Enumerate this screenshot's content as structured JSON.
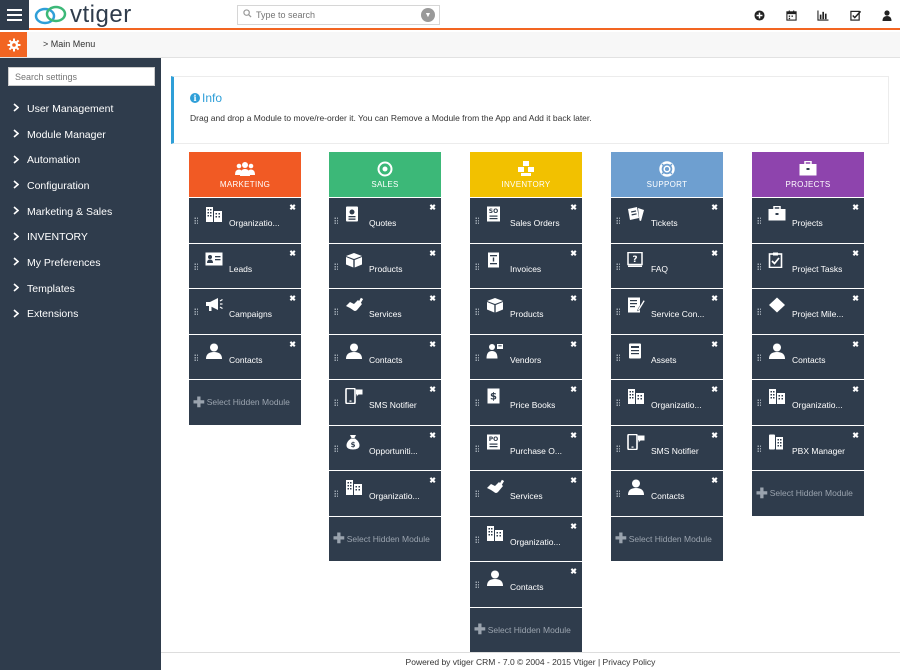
{
  "app": {
    "logo_text": "vtiger"
  },
  "search": {
    "placeholder": "Type to search"
  },
  "header_icons": [
    "plus-circle-icon",
    "calendar-icon",
    "bar-chart-icon",
    "checkbox-icon",
    "user-icon"
  ],
  "breadcrumb": {
    "text": "> Main Menu"
  },
  "sidebar": {
    "search_placeholder": "Search settings",
    "items": [
      {
        "label": "User Management"
      },
      {
        "label": "Module Manager"
      },
      {
        "label": "Automation"
      },
      {
        "label": "Configuration"
      },
      {
        "label": "Marketing & Sales"
      },
      {
        "label": "INVENTORY"
      },
      {
        "label": "My Preferences"
      },
      {
        "label": "Templates"
      },
      {
        "label": "Extensions"
      }
    ]
  },
  "info": {
    "title": "Info",
    "text": "Drag and drop a Module to move/re-order it. You can Remove a Module from the App and Add it back later."
  },
  "hidden_label": "Select Hidden Module",
  "columns": [
    {
      "name": "MARKETING",
      "color": "#f15a24",
      "icon": "users-icon",
      "modules": [
        {
          "label": "Organizatio...",
          "icon": "building-icon"
        },
        {
          "label": "Leads",
          "icon": "id-card-icon"
        },
        {
          "label": "Campaigns",
          "icon": "megaphone-icon"
        },
        {
          "label": "Contacts",
          "icon": "person-icon"
        }
      ]
    },
    {
      "name": "SALES",
      "color": "#3cb878",
      "icon": "target-icon",
      "modules": [
        {
          "label": "Quotes",
          "icon": "quote-doc-icon"
        },
        {
          "label": "Products",
          "icon": "box-icon"
        },
        {
          "label": "Services",
          "icon": "handshake-icon"
        },
        {
          "label": "Contacts",
          "icon": "person-icon"
        },
        {
          "label": "SMS Notifier",
          "icon": "phone-sms-icon"
        },
        {
          "label": "Opportuniti...",
          "icon": "money-bag-icon"
        },
        {
          "label": "Organizatio...",
          "icon": "building-icon"
        }
      ]
    },
    {
      "name": "INVENTORY",
      "color": "#f2c100",
      "icon": "boxes-icon",
      "modules": [
        {
          "label": "Sales Orders",
          "icon": "so-doc-icon"
        },
        {
          "label": "Invoices",
          "icon": "invoice-icon"
        },
        {
          "label": "Products",
          "icon": "box-icon"
        },
        {
          "label": "Vendors",
          "icon": "vendor-icon"
        },
        {
          "label": "Price Books",
          "icon": "pricebook-icon"
        },
        {
          "label": "Purchase O...",
          "icon": "po-doc-icon"
        },
        {
          "label": "Services",
          "icon": "handshake-icon"
        },
        {
          "label": "Organizatio...",
          "icon": "building-icon"
        },
        {
          "label": "Contacts",
          "icon": "person-icon"
        }
      ]
    },
    {
      "name": "SUPPORT",
      "color": "#6e9fd0",
      "icon": "lifebuoy-icon",
      "modules": [
        {
          "label": "Tickets",
          "icon": "ticket-icon"
        },
        {
          "label": "FAQ",
          "icon": "faq-icon"
        },
        {
          "label": "Service Con...",
          "icon": "contract-icon"
        },
        {
          "label": "Assets",
          "icon": "assets-icon"
        },
        {
          "label": "Organizatio...",
          "icon": "building-icon"
        },
        {
          "label": "SMS Notifier",
          "icon": "phone-sms-icon"
        },
        {
          "label": "Contacts",
          "icon": "person-icon"
        }
      ]
    },
    {
      "name": "PROJECTS",
      "color": "#8e44ad",
      "icon": "briefcase-icon",
      "modules": [
        {
          "label": "Projects",
          "icon": "briefcase-icon"
        },
        {
          "label": "Project Tasks",
          "icon": "clipboard-icon"
        },
        {
          "label": "Project Mile...",
          "icon": "diamond-icon"
        },
        {
          "label": "Contacts",
          "icon": "person-icon"
        },
        {
          "label": "Organizatio...",
          "icon": "building-icon"
        },
        {
          "label": "PBX Manager",
          "icon": "pbx-icon"
        }
      ]
    }
  ],
  "footer": {
    "text": "Powered by vtiger CRM - 7.0  © 2004 - 2015  Vtiger |  Privacy Policy"
  }
}
